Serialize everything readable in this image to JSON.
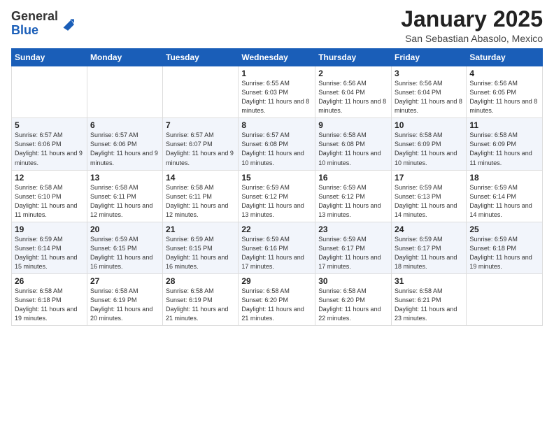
{
  "logo": {
    "general": "General",
    "blue": "Blue"
  },
  "title": "January 2025",
  "location": "San Sebastian Abasolo, Mexico",
  "days_of_week": [
    "Sunday",
    "Monday",
    "Tuesday",
    "Wednesday",
    "Thursday",
    "Friday",
    "Saturday"
  ],
  "weeks": [
    [
      {
        "day": "",
        "info": ""
      },
      {
        "day": "",
        "info": ""
      },
      {
        "day": "",
        "info": ""
      },
      {
        "day": "1",
        "info": "Sunrise: 6:55 AM\nSunset: 6:03 PM\nDaylight: 11 hours and 8 minutes."
      },
      {
        "day": "2",
        "info": "Sunrise: 6:56 AM\nSunset: 6:04 PM\nDaylight: 11 hours and 8 minutes."
      },
      {
        "day": "3",
        "info": "Sunrise: 6:56 AM\nSunset: 6:04 PM\nDaylight: 11 hours and 8 minutes."
      },
      {
        "day": "4",
        "info": "Sunrise: 6:56 AM\nSunset: 6:05 PM\nDaylight: 11 hours and 8 minutes."
      }
    ],
    [
      {
        "day": "5",
        "info": "Sunrise: 6:57 AM\nSunset: 6:06 PM\nDaylight: 11 hours and 9 minutes."
      },
      {
        "day": "6",
        "info": "Sunrise: 6:57 AM\nSunset: 6:06 PM\nDaylight: 11 hours and 9 minutes."
      },
      {
        "day": "7",
        "info": "Sunrise: 6:57 AM\nSunset: 6:07 PM\nDaylight: 11 hours and 9 minutes."
      },
      {
        "day": "8",
        "info": "Sunrise: 6:57 AM\nSunset: 6:08 PM\nDaylight: 11 hours and 10 minutes."
      },
      {
        "day": "9",
        "info": "Sunrise: 6:58 AM\nSunset: 6:08 PM\nDaylight: 11 hours and 10 minutes."
      },
      {
        "day": "10",
        "info": "Sunrise: 6:58 AM\nSunset: 6:09 PM\nDaylight: 11 hours and 10 minutes."
      },
      {
        "day": "11",
        "info": "Sunrise: 6:58 AM\nSunset: 6:09 PM\nDaylight: 11 hours and 11 minutes."
      }
    ],
    [
      {
        "day": "12",
        "info": "Sunrise: 6:58 AM\nSunset: 6:10 PM\nDaylight: 11 hours and 11 minutes."
      },
      {
        "day": "13",
        "info": "Sunrise: 6:58 AM\nSunset: 6:11 PM\nDaylight: 11 hours and 12 minutes."
      },
      {
        "day": "14",
        "info": "Sunrise: 6:58 AM\nSunset: 6:11 PM\nDaylight: 11 hours and 12 minutes."
      },
      {
        "day": "15",
        "info": "Sunrise: 6:59 AM\nSunset: 6:12 PM\nDaylight: 11 hours and 13 minutes."
      },
      {
        "day": "16",
        "info": "Sunrise: 6:59 AM\nSunset: 6:12 PM\nDaylight: 11 hours and 13 minutes."
      },
      {
        "day": "17",
        "info": "Sunrise: 6:59 AM\nSunset: 6:13 PM\nDaylight: 11 hours and 14 minutes."
      },
      {
        "day": "18",
        "info": "Sunrise: 6:59 AM\nSunset: 6:14 PM\nDaylight: 11 hours and 14 minutes."
      }
    ],
    [
      {
        "day": "19",
        "info": "Sunrise: 6:59 AM\nSunset: 6:14 PM\nDaylight: 11 hours and 15 minutes."
      },
      {
        "day": "20",
        "info": "Sunrise: 6:59 AM\nSunset: 6:15 PM\nDaylight: 11 hours and 16 minutes."
      },
      {
        "day": "21",
        "info": "Sunrise: 6:59 AM\nSunset: 6:15 PM\nDaylight: 11 hours and 16 minutes."
      },
      {
        "day": "22",
        "info": "Sunrise: 6:59 AM\nSunset: 6:16 PM\nDaylight: 11 hours and 17 minutes."
      },
      {
        "day": "23",
        "info": "Sunrise: 6:59 AM\nSunset: 6:17 PM\nDaylight: 11 hours and 17 minutes."
      },
      {
        "day": "24",
        "info": "Sunrise: 6:59 AM\nSunset: 6:17 PM\nDaylight: 11 hours and 18 minutes."
      },
      {
        "day": "25",
        "info": "Sunrise: 6:59 AM\nSunset: 6:18 PM\nDaylight: 11 hours and 19 minutes."
      }
    ],
    [
      {
        "day": "26",
        "info": "Sunrise: 6:58 AM\nSunset: 6:18 PM\nDaylight: 11 hours and 19 minutes."
      },
      {
        "day": "27",
        "info": "Sunrise: 6:58 AM\nSunset: 6:19 PM\nDaylight: 11 hours and 20 minutes."
      },
      {
        "day": "28",
        "info": "Sunrise: 6:58 AM\nSunset: 6:19 PM\nDaylight: 11 hours and 21 minutes."
      },
      {
        "day": "29",
        "info": "Sunrise: 6:58 AM\nSunset: 6:20 PM\nDaylight: 11 hours and 21 minutes."
      },
      {
        "day": "30",
        "info": "Sunrise: 6:58 AM\nSunset: 6:20 PM\nDaylight: 11 hours and 22 minutes."
      },
      {
        "day": "31",
        "info": "Sunrise: 6:58 AM\nSunset: 6:21 PM\nDaylight: 11 hours and 23 minutes."
      },
      {
        "day": "",
        "info": ""
      }
    ]
  ]
}
